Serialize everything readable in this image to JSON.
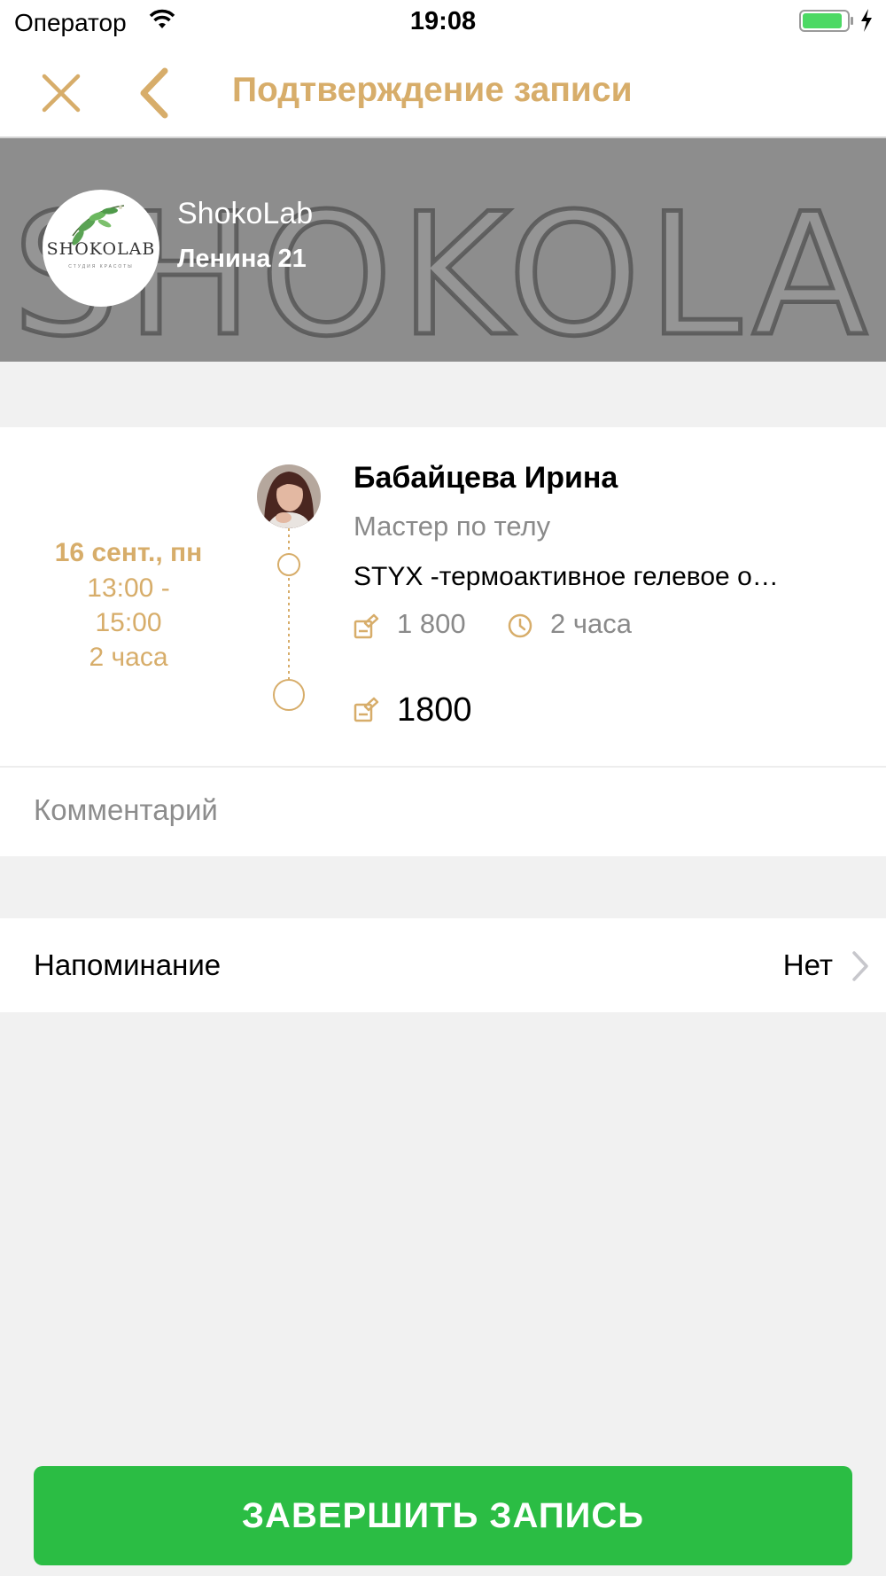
{
  "status_bar": {
    "carrier": "Оператор",
    "time": "19:08",
    "battery_level": 0.9
  },
  "nav": {
    "title": "Подтверждение записи",
    "close_icon": "close-icon",
    "back_icon": "chevron-left-icon"
  },
  "salon": {
    "banner_text": "SHOKOLAB",
    "logo_text": "SHOKOLAB",
    "logo_subtitle": "СТУДИЯ КРАСОТЫ",
    "name": "ShokoLab",
    "address": "Ленина 21"
  },
  "appointment": {
    "date": "16 сент., пн",
    "time_start": "13:00 -",
    "time_end": "15:00",
    "duration": "2 часа",
    "master_name": "Бабайцева Ирина",
    "master_role": "Мастер по телу",
    "service_name": "STYX -термоактивное гелевое о…",
    "service_price": "1 800",
    "service_duration": "2 часа",
    "total_price": "1800"
  },
  "comment": {
    "placeholder": "Комментарий",
    "value": ""
  },
  "reminder": {
    "label": "Напоминание",
    "value": "Нет"
  },
  "actions": {
    "finish_label": "ЗАВЕРШИТЬ ЗАПИСЬ"
  },
  "colors": {
    "accent": "#d7ad6a",
    "success": "#2bbd44",
    "background": "#f1f1f1",
    "secondary_text": "#8a8a8a"
  }
}
